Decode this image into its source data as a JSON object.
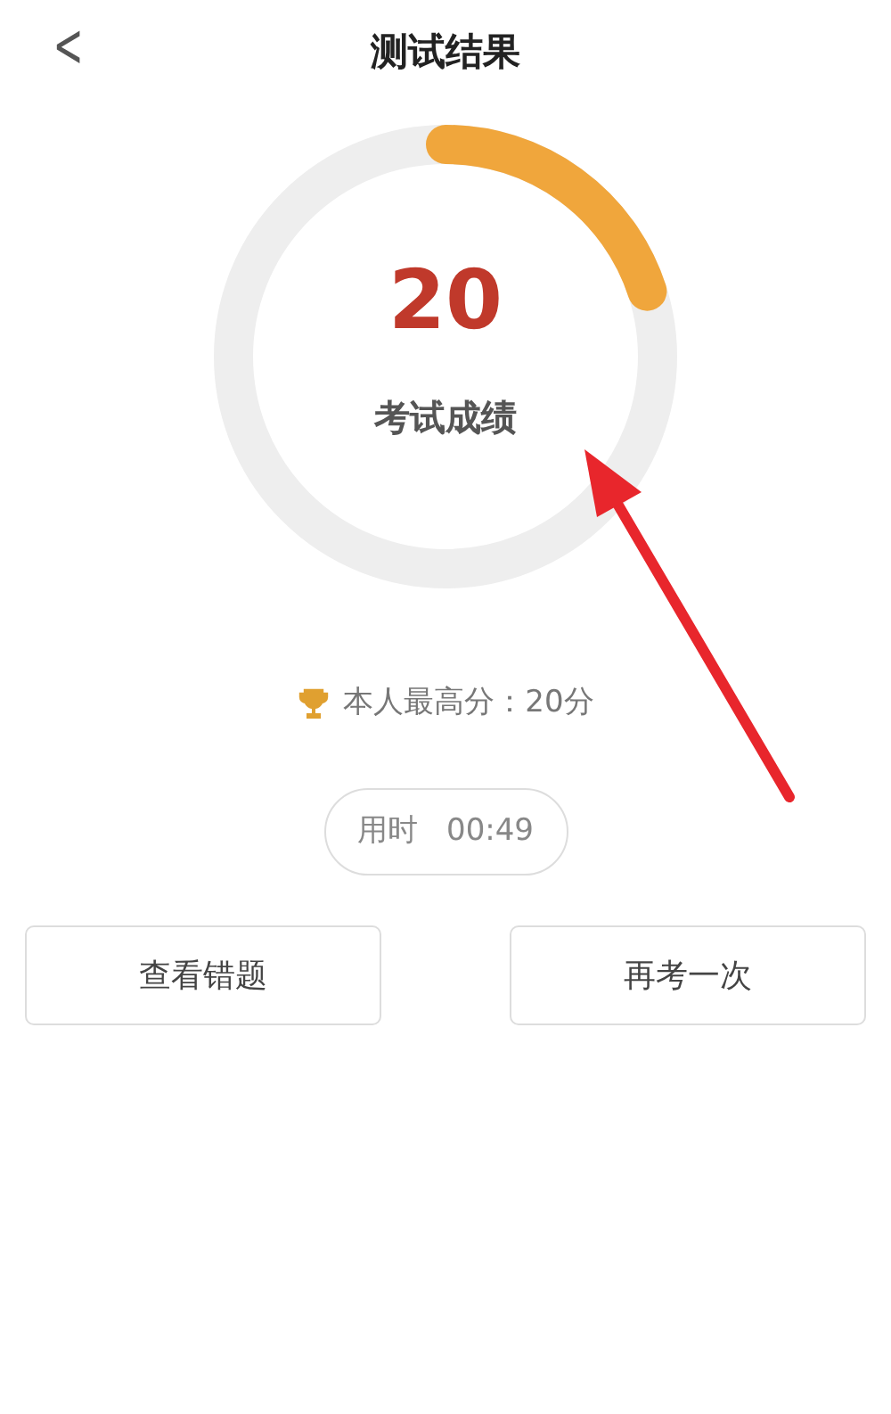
{
  "header": {
    "back": "<",
    "title": "测试结果"
  },
  "result": {
    "score": "20",
    "label": "考试成绩"
  },
  "best": "本人最高分：20分",
  "time": {
    "label": "用时",
    "value": "00:49"
  },
  "buttons": [
    "查看错题",
    "再考一次"
  ],
  "annotation": {
    "kind": "arrow"
  }
}
